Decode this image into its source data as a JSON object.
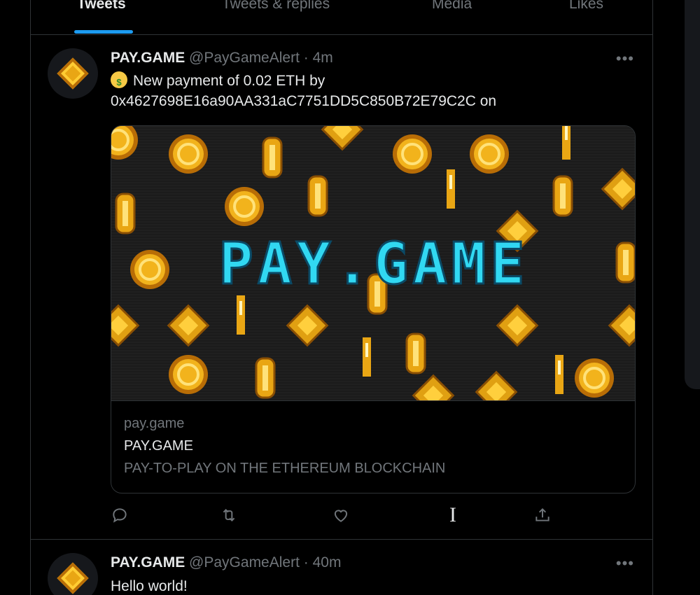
{
  "tabs": [
    {
      "label": "Tweets",
      "active": true
    },
    {
      "label": "Tweets & replies",
      "active": false
    },
    {
      "label": "Media",
      "active": false
    },
    {
      "label": "Likes",
      "active": false
    }
  ],
  "tweets": [
    {
      "name": "PAY.GAME",
      "handle": "@PayGameAlert",
      "time": "4m",
      "emoji": "money-mouth-face",
      "text_line1": "New payment of 0.02 ETH by",
      "text_line2": "0x4627698E16a90AA331aC7751DD5C850B72E79C2C on",
      "card": {
        "logo_text": "PAY.GAME",
        "domain": "pay.game",
        "title": "PAY.GAME",
        "description": "PAY-TO-PLAY ON THE ETHEREUM BLOCKCHAIN"
      },
      "actions": [
        "reply-icon",
        "retweet-icon",
        "like-icon",
        "share-icon"
      ]
    },
    {
      "name": "PAY.GAME",
      "handle": "@PayGameAlert",
      "time": "40m",
      "text_line1": "Hello world!"
    }
  ],
  "colors": {
    "accent": "#1d9bf0",
    "coin": "#e9a614",
    "logo": "#31d8f2",
    "background": "#000000",
    "muted": "#71767b"
  },
  "separator": "·",
  "more_glyph": "•••"
}
